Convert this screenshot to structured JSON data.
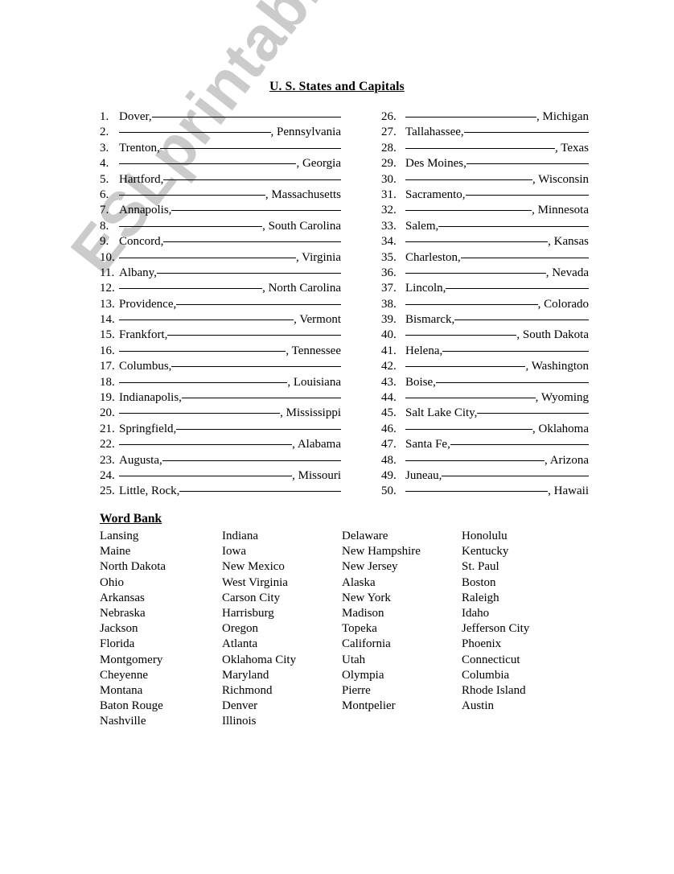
{
  "document": {
    "title": "U. S. States and Capitals",
    "watermark": "ESLprintables.com"
  },
  "exercise": {
    "left_column": [
      {
        "num": "1.",
        "text": "Dover,",
        "blank": "____________________",
        "tail": ""
      },
      {
        "num": "2.",
        "text": "",
        "blank": "____________________",
        "tail": ", Pennsylvania"
      },
      {
        "num": "3.",
        "text": "Trenton,",
        "blank": "____________________",
        "tail": ""
      },
      {
        "num": "4.",
        "text": "",
        "blank": "____________________",
        "tail": ", Georgia"
      },
      {
        "num": "5.",
        "text": "Hartford,",
        "blank": "____________________",
        "tail": ""
      },
      {
        "num": "6.",
        "text": "",
        "blank": "____________________",
        "tail": ", Massachusetts"
      },
      {
        "num": "7.",
        "text": "Annapolis,",
        "blank": "____________________",
        "tail": ""
      },
      {
        "num": "8.",
        "text": "",
        "blank": "____________________",
        "tail": ", South Carolina"
      },
      {
        "num": "9.",
        "text": "Concord,",
        "blank": "____________________",
        "tail": ""
      },
      {
        "num": "10.",
        "text": "",
        "blank": "____________________",
        "tail": ", Virginia"
      },
      {
        "num": "11.",
        "text": "Albany,",
        "blank": "____________________",
        "tail": ""
      },
      {
        "num": "12.",
        "text": "",
        "blank": "____________________",
        "tail": ", North Carolina"
      },
      {
        "num": "13.",
        "text": "Providence,",
        "blank": "____________________",
        "tail": ""
      },
      {
        "num": "14.",
        "text": "",
        "blank": "____________________",
        "tail": ", Vermont"
      },
      {
        "num": "15.",
        "text": "Frankfort,",
        "blank": "____________________",
        "tail": ""
      },
      {
        "num": "16.",
        "text": "",
        "blank": "____________________",
        "tail": ", Tennessee"
      },
      {
        "num": "17.",
        "text": "Columbus,",
        "blank": "____________________",
        "tail": ""
      },
      {
        "num": "18.",
        "text": "",
        "blank": "____________________",
        "tail": ", Louisiana"
      },
      {
        "num": "19.",
        "text": "Indianapolis,",
        "blank": "____________________",
        "tail": ""
      },
      {
        "num": "20.",
        "text": "",
        "blank": "____________________",
        "tail": ", Mississippi"
      },
      {
        "num": "21.",
        "text": "Springfield,",
        "blank": "____________________",
        "tail": ""
      },
      {
        "num": "22.",
        "text": "",
        "blank": "____________________",
        "tail": ", Alabama"
      },
      {
        "num": "23.",
        "text": "Augusta,",
        "blank": "____________________",
        "tail": ""
      },
      {
        "num": "24.",
        "text": "",
        "blank": "____________________",
        "tail": ", Missouri"
      },
      {
        "num": "25.",
        "text": "Little, Rock,",
        "blank": "____________________",
        "tail": ""
      }
    ],
    "right_column": [
      {
        "num": "26.",
        "text": "",
        "blank": "____________________",
        "tail": ", Michigan"
      },
      {
        "num": "27.",
        "text": "Tallahassee,",
        "blank": "____________________",
        "tail": ""
      },
      {
        "num": "28.",
        "text": "",
        "blank": "____________________",
        "tail": ", Texas"
      },
      {
        "num": "29.",
        "text": "Des Moines,",
        "blank": "____________________",
        "tail": ""
      },
      {
        "num": "30.",
        "text": "",
        "blank": "____________________",
        "tail": ", Wisconsin"
      },
      {
        "num": "31.",
        "text": "Sacramento,",
        "blank": "____________________",
        "tail": ""
      },
      {
        "num": "32.",
        "text": "",
        "blank": "____________________",
        "tail": ", Minnesota"
      },
      {
        "num": "33.",
        "text": "Salem,",
        "blank": "____________________",
        "tail": ""
      },
      {
        "num": "34.",
        "text": "",
        "blank": "____________________",
        "tail": ", Kansas"
      },
      {
        "num": "35.",
        "text": "Charleston,",
        "blank": "____________________",
        "tail": ""
      },
      {
        "num": "36.",
        "text": "",
        "blank": "____________________",
        "tail": ", Nevada"
      },
      {
        "num": "37.",
        "text": "Lincoln,",
        "blank": "____________________",
        "tail": ""
      },
      {
        "num": "38.",
        "text": "",
        "blank": "____________________",
        "tail": ", Colorado"
      },
      {
        "num": "39.",
        "text": "Bismarck,",
        "blank": "____________________",
        "tail": ""
      },
      {
        "num": "40.",
        "text": "",
        "blank": "____________________",
        "tail": ", South Dakota"
      },
      {
        "num": "41.",
        "text": "Helena,",
        "blank": "____________________",
        "tail": ""
      },
      {
        "num": "42.",
        "text": "",
        "blank": "____________________",
        "tail": ", Washington"
      },
      {
        "num": "43.",
        "text": "Boise,",
        "blank": "____________________",
        "tail": ""
      },
      {
        "num": "44.",
        "text": "",
        "blank": "____________________",
        "tail": ", Wyoming"
      },
      {
        "num": "45.",
        "text": "Salt Lake City,",
        "blank": "____________________",
        "tail": ""
      },
      {
        "num": "46.",
        "text": "",
        "blank": "____________________",
        "tail": ", Oklahoma"
      },
      {
        "num": "47.",
        "text": "Santa Fe,",
        "blank": "____________________",
        "tail": ""
      },
      {
        "num": "48.",
        "text": "",
        "blank": "____________________",
        "tail": ", Arizona"
      },
      {
        "num": "49.",
        "text": "Juneau,",
        "blank": "____________________",
        "tail": ""
      },
      {
        "num": "50.",
        "text": "",
        "blank": "____________________",
        "tail": ", Hawaii"
      }
    ]
  },
  "word_bank": {
    "heading": "Word Bank",
    "columns": [
      [
        "Lansing",
        "Maine",
        "North Dakota",
        "Ohio",
        "Arkansas",
        "Nebraska",
        "Jackson",
        "Florida",
        "Montgomery",
        "Cheyenne",
        "Montana",
        "Baton Rouge",
        "Nashville"
      ],
      [
        "Indiana",
        "Iowa",
        "New Mexico",
        "West Virginia",
        "Carson City",
        "Harrisburg",
        "Oregon",
        "Atlanta",
        "Oklahoma City",
        "Maryland",
        "Richmond",
        "Denver",
        "Illinois"
      ],
      [
        "Delaware",
        "New Hampshire",
        "New Jersey",
        "Alaska",
        "New York",
        "Madison",
        "Topeka",
        "California",
        "Utah",
        "Olympia",
        "Pierre",
        "Montpelier"
      ],
      [
        "Honolulu",
        "Kentucky",
        "St. Paul",
        "Boston",
        "Raleigh",
        "Idaho",
        "Jefferson City",
        "Phoenix",
        "Connecticut",
        "Columbia",
        "Rhode Island",
        "Austin"
      ]
    ]
  }
}
